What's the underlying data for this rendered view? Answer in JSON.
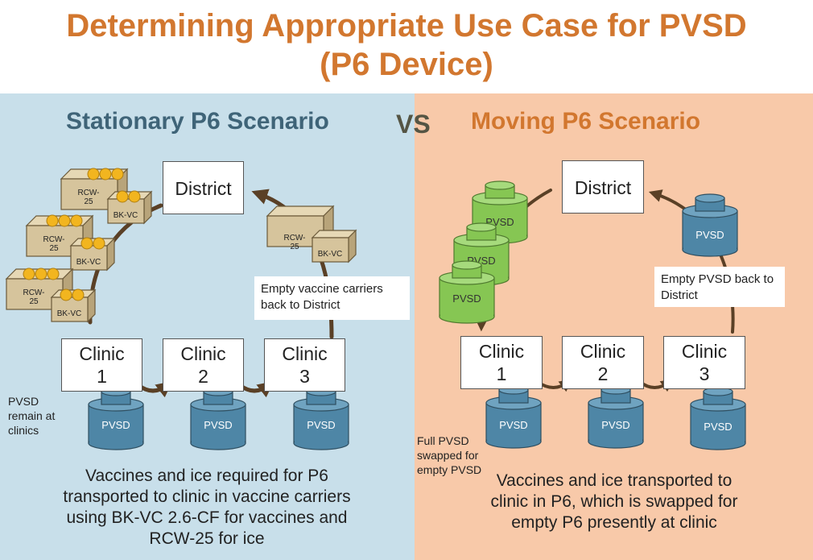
{
  "title_line1": "Determining Appropriate Use Case for PVSD",
  "title_line2": "(P6 Device)",
  "vs_label": "VS",
  "left": {
    "heading": "Stationary P6 Scenario",
    "district": "District",
    "clinic1_line1": "Clinic",
    "clinic1_line2": "1",
    "clinic2_line1": "Clinic",
    "clinic2_line2": "2",
    "clinic3_line1": "Clinic",
    "clinic3_line2": "3",
    "note": "Empty vaccine carriers back to District",
    "side_note": "PVSD remain at clinics",
    "caption": "Vaccines and ice required for P6 transported to clinic in vaccine carriers using BK-VC 2.6-CF for vaccines and RCW-25 for ice",
    "pvsd_label": "PVSD",
    "rcw_label": "RCW-25",
    "bkvc_label": "BK-VC"
  },
  "right": {
    "heading": "Moving P6 Scenario",
    "district": "District",
    "clinic1_line1": "Clinic",
    "clinic1_line2": "1",
    "clinic2_line1": "Clinic",
    "clinic2_line2": "2",
    "clinic3_line1": "Clinic",
    "clinic3_line2": "3",
    "note": "Empty PVSD back to District",
    "side_note": "Full PVSD swapped for empty PVSD",
    "caption": "Vaccines and ice transported to clinic in P6, which is swapped for empty P6 presently at clinic",
    "pvsd_label": "PVSD"
  },
  "colors": {
    "title": "#D2772F",
    "left_bg": "#C8DFEA",
    "right_bg": "#F8C9A9",
    "left_heading": "#3F6478",
    "pvsd_blue": "#4E86A6",
    "pvsd_green": "#86C653",
    "carrier_tan": "#D6C49C",
    "ice_yellow": "#F2B51F",
    "arrow": "#5A4026"
  }
}
